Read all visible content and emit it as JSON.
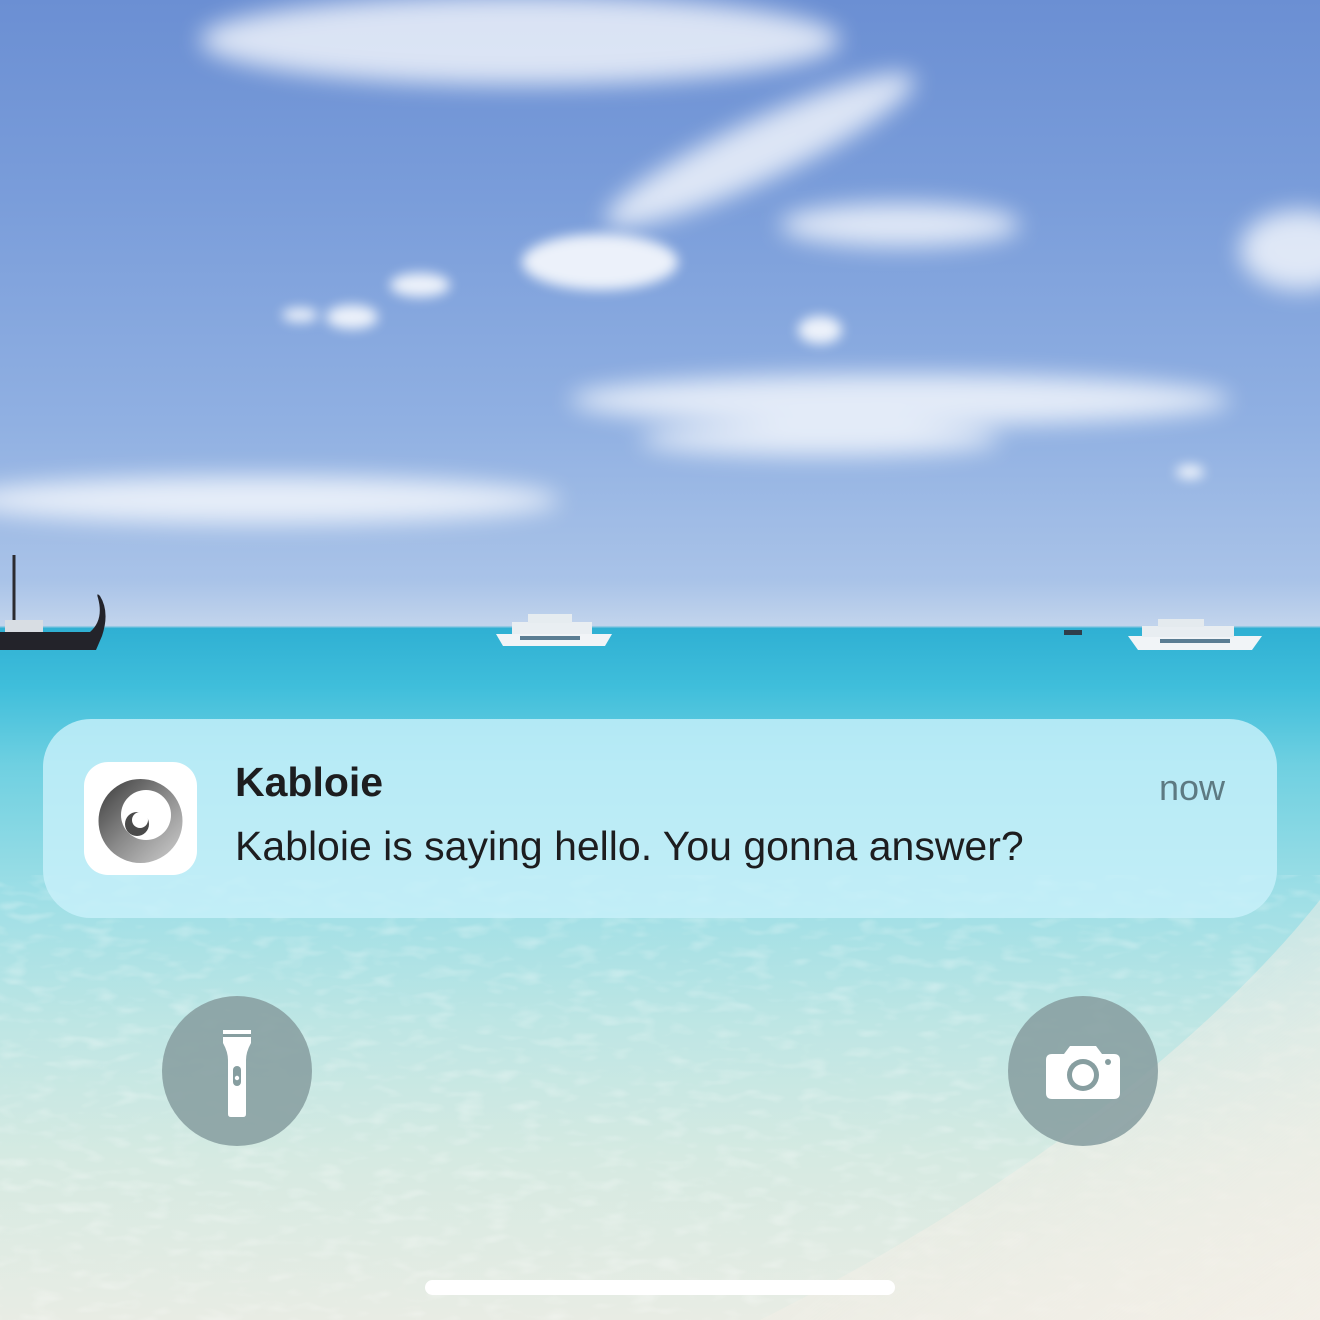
{
  "notification": {
    "app_name": "Kabloie",
    "time": "now",
    "message": "Kabloie is saying hello. You gonna answer?",
    "app_icon": "swirl-icon"
  },
  "controls": {
    "left": {
      "icon": "flashlight-icon"
    },
    "right": {
      "icon": "camera-icon"
    }
  },
  "colors": {
    "notification_bg": "#c8f0fa",
    "button_bg": "#879ea0",
    "text": "#1d1d1f",
    "time_text": "#5d7a82"
  }
}
